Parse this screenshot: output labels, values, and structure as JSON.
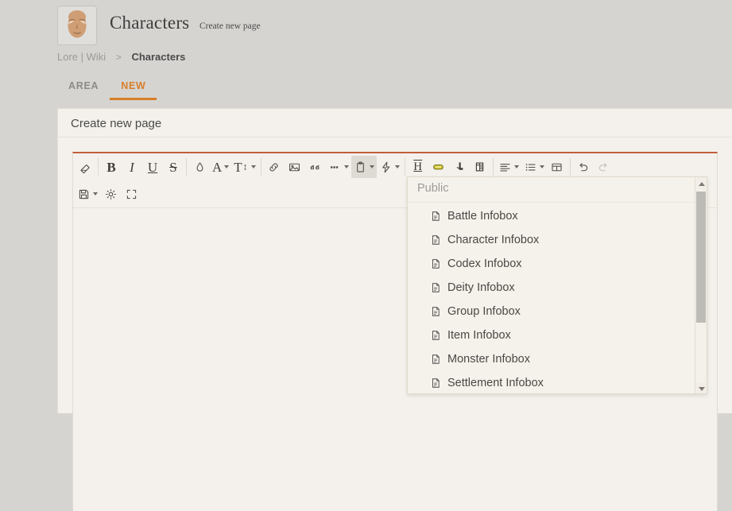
{
  "colors": {
    "page_background": "#d5d4d1",
    "panel_background": "#f4f1ec",
    "accent": "#d97e28",
    "editor_top_border": "#bf5f3d",
    "highlight_pill": "#c9c12f"
  },
  "header": {
    "avatar_name": "character-face-avatar",
    "title": "Characters",
    "subtitle": "Create new page"
  },
  "breadcrumb": {
    "root": "Lore | Wiki",
    "separator": ">",
    "current": "Characters"
  },
  "tabs": [
    {
      "label": "AREA",
      "active": false
    },
    {
      "label": "NEW",
      "active": true
    }
  ],
  "panel": {
    "title": "Create new page"
  },
  "editor": {
    "toolbar_row1": [
      {
        "name": "clear-formatting-icon",
        "label": "Clear formatting",
        "type": "eraser",
        "caret": false,
        "active": false,
        "disabled": false
      },
      {
        "name": "bold-icon",
        "label": "B",
        "type": "glyph-b",
        "caret": false,
        "active": false,
        "disabled": false
      },
      {
        "name": "italic-icon",
        "label": "I",
        "type": "glyph-i",
        "caret": false,
        "active": false,
        "disabled": false
      },
      {
        "name": "underline-icon",
        "label": "U",
        "type": "glyph-u",
        "caret": false,
        "active": false,
        "disabled": false
      },
      {
        "name": "strikethrough-icon",
        "label": "S",
        "type": "glyph-s",
        "caret": false,
        "active": false,
        "disabled": false
      },
      {
        "name": "text-color-droplet-icon",
        "label": "Text color",
        "type": "droplet",
        "caret": false,
        "active": false,
        "disabled": false
      },
      {
        "name": "font-family-icon",
        "label": "A",
        "type": "glyph-a",
        "caret": true,
        "active": false,
        "disabled": false
      },
      {
        "name": "font-size-icon",
        "label": "T",
        "type": "fontsize",
        "caret": true,
        "active": false,
        "disabled": false
      },
      {
        "name": "link-icon",
        "label": "Insert link",
        "type": "link",
        "caret": false,
        "active": false,
        "disabled": false
      },
      {
        "name": "image-icon",
        "label": "Insert image",
        "type": "image",
        "caret": false,
        "active": false,
        "disabled": false
      },
      {
        "name": "blockquote-icon",
        "label": "Quote",
        "type": "quote",
        "caret": false,
        "active": false,
        "disabled": false
      },
      {
        "name": "more-options-icon",
        "label": "More",
        "type": "ellipsis",
        "caret": true,
        "active": false,
        "disabled": false
      },
      {
        "name": "template-clipboard-icon",
        "label": "Templates",
        "type": "clipboard",
        "caret": true,
        "active": true,
        "disabled": false
      },
      {
        "name": "special-insert-bolt-icon",
        "label": "Insert",
        "type": "bolt",
        "caret": true,
        "active": false,
        "disabled": false
      },
      {
        "name": "horizontal-rule-icon",
        "label": "H",
        "type": "hrule",
        "caret": false,
        "active": false,
        "disabled": false
      },
      {
        "name": "highlight-marker-icon",
        "label": "Highlight",
        "type": "pill",
        "caret": false,
        "active": false,
        "disabled": false
      },
      {
        "name": "indent-icon",
        "label": "Indent",
        "type": "boot",
        "caret": false,
        "active": false,
        "disabled": false
      },
      {
        "name": "columns-icon",
        "label": "Columns",
        "type": "columns",
        "caret": false,
        "active": false,
        "disabled": false
      },
      {
        "name": "align-icon",
        "label": "Align",
        "type": "align",
        "caret": true,
        "active": false,
        "disabled": false
      },
      {
        "name": "list-icon",
        "label": "List",
        "type": "list",
        "caret": true,
        "active": false,
        "disabled": false
      },
      {
        "name": "table-icon",
        "label": "Table",
        "type": "table",
        "caret": false,
        "active": false,
        "disabled": false
      },
      {
        "name": "undo-icon",
        "label": "Undo",
        "type": "undo",
        "caret": false,
        "active": false,
        "disabled": false
      },
      {
        "name": "redo-icon",
        "label": "Redo",
        "type": "redo",
        "caret": false,
        "active": false,
        "disabled": true
      }
    ],
    "toolbar_row2": [
      {
        "name": "save-icon",
        "label": "Save",
        "type": "save",
        "caret": true,
        "active": false,
        "disabled": false
      },
      {
        "name": "settings-gear-icon",
        "label": "Settings",
        "type": "gear",
        "caret": false,
        "active": false,
        "disabled": false
      },
      {
        "name": "fullscreen-icon",
        "label": "Fullscreen",
        "type": "fullscreen",
        "caret": false,
        "active": false,
        "disabled": false
      }
    ],
    "content": ""
  },
  "dropdown": {
    "group_label": "Public",
    "items": [
      {
        "label": "Battle Infobox"
      },
      {
        "label": "Character Infobox"
      },
      {
        "label": "Codex Infobox"
      },
      {
        "label": "Deity Infobox"
      },
      {
        "label": "Group Infobox"
      },
      {
        "label": "Item Infobox"
      },
      {
        "label": "Monster Infobox"
      },
      {
        "label": "Settlement Infobox"
      }
    ],
    "scroll_up_icon": "scroll-up-arrow",
    "scroll_down_icon": "scroll-down-arrow"
  }
}
